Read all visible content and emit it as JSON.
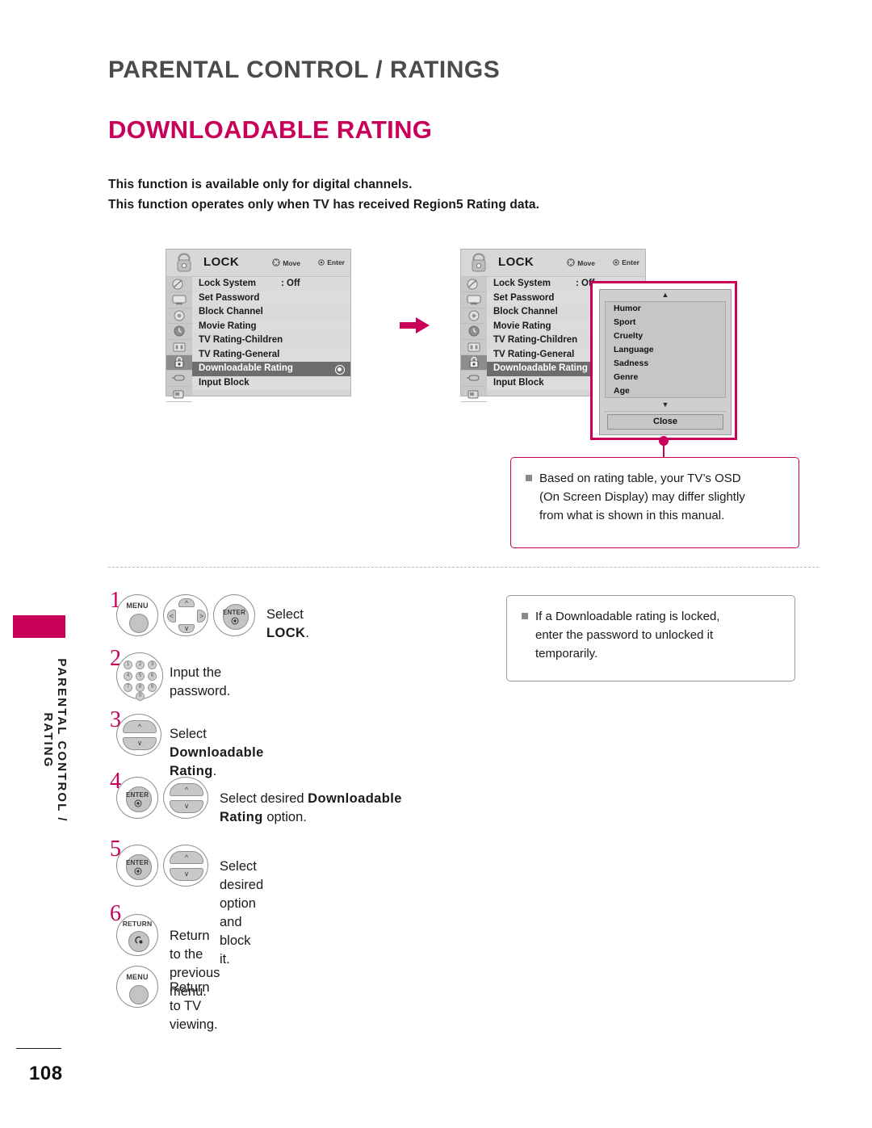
{
  "header": {
    "section_title": "PARENTAL CONTROL / RATINGS",
    "page_title": "DOWNLOADABLE RATING",
    "intro_line_1": "This function is available only for digital channels.",
    "intro_line_2": "This function operates only when TV has received Region5 Rating data."
  },
  "side_tab": {
    "label": "PARENTAL CONTROL / RATING"
  },
  "osd": {
    "title": "LOCK",
    "hint_move": "Move",
    "hint_enter": "Enter",
    "menu_items": [
      {
        "label": "Lock System",
        "value": ": Off"
      },
      {
        "label": "Set Password",
        "value": ""
      },
      {
        "label": "Block Channel",
        "value": ""
      },
      {
        "label": "Movie Rating",
        "value": ""
      },
      {
        "label": "TV Rating-Children",
        "value": ""
      },
      {
        "label": "TV Rating-General",
        "value": ""
      },
      {
        "label": "Downloadable Rating",
        "value": ""
      },
      {
        "label": "Input Block",
        "value": ""
      }
    ],
    "highlighted_index": 6,
    "icon_names": [
      "picture-icon",
      "screen-icon",
      "audio-icon",
      "time-icon",
      "setup-icon",
      "lock-icon",
      "input-icon",
      "usb-icon"
    ]
  },
  "popup": {
    "up_arrow": "▲",
    "down_arrow": "▼",
    "items": [
      "Humor",
      "Sport",
      "Cruelty",
      "Language",
      "Sadness",
      "Genre",
      "Age"
    ],
    "close_label": "Close"
  },
  "notes": [
    {
      "bullet_line": "Based on rating table, your TV’s OSD",
      "line_2": "(On Screen Display) may differ slightly",
      "line_3": "from what is shown in this manual."
    },
    {
      "bullet_line": "If a Downloadable rating is locked,",
      "line_2": "enter the password to unlocked it",
      "line_3": "temporarily."
    }
  ],
  "steps": [
    {
      "number": "1",
      "buttons": [
        "MENU",
        "nav-pad",
        "ENTER"
      ],
      "text_plain": "Select ",
      "text_bold": "LOCK",
      "text_tail": "."
    },
    {
      "number": "2",
      "buttons": [
        "number-keypad"
      ],
      "text_plain": "Input the password.",
      "text_bold": "",
      "text_tail": ""
    },
    {
      "number": "3",
      "buttons": [
        "up-down"
      ],
      "text_plain": "Select ",
      "text_bold": "Downloadable Rating",
      "text_tail": "."
    },
    {
      "number": "4",
      "buttons": [
        "ENTER",
        "up-down"
      ],
      "text_plain": "Select desired ",
      "text_bold": "Downloadable",
      "text_tail": "",
      "line2_bold": "Rating",
      "line2_tail": " option."
    },
    {
      "number": "5",
      "buttons": [
        "ENTER",
        "up-down"
      ],
      "text_plain": "Select desired option and block it.",
      "text_bold": "",
      "text_tail": ""
    },
    {
      "number": "6",
      "buttons": [
        "RETURN"
      ],
      "text_plain": "Return to the previous menu.",
      "text_bold": "",
      "text_tail": ""
    },
    {
      "number": "",
      "buttons": [
        "MENU"
      ],
      "text_plain": "Return to TV viewing.",
      "text_bold": "",
      "text_tail": ""
    }
  ],
  "button_labels": {
    "menu": "MENU",
    "enter": "ENTER",
    "return": "RETURN"
  },
  "keypad_keys": [
    "1",
    "2",
    "3",
    "4",
    "5",
    "6",
    "7",
    "8",
    "9",
    "0"
  ],
  "footer": {
    "page_number": "108"
  },
  "colors": {
    "accent": "#c8005a",
    "title_gray": "#4b4b4b",
    "osd_bg": "#d4d4d4",
    "osd_highlight": "#6d6d6d"
  }
}
